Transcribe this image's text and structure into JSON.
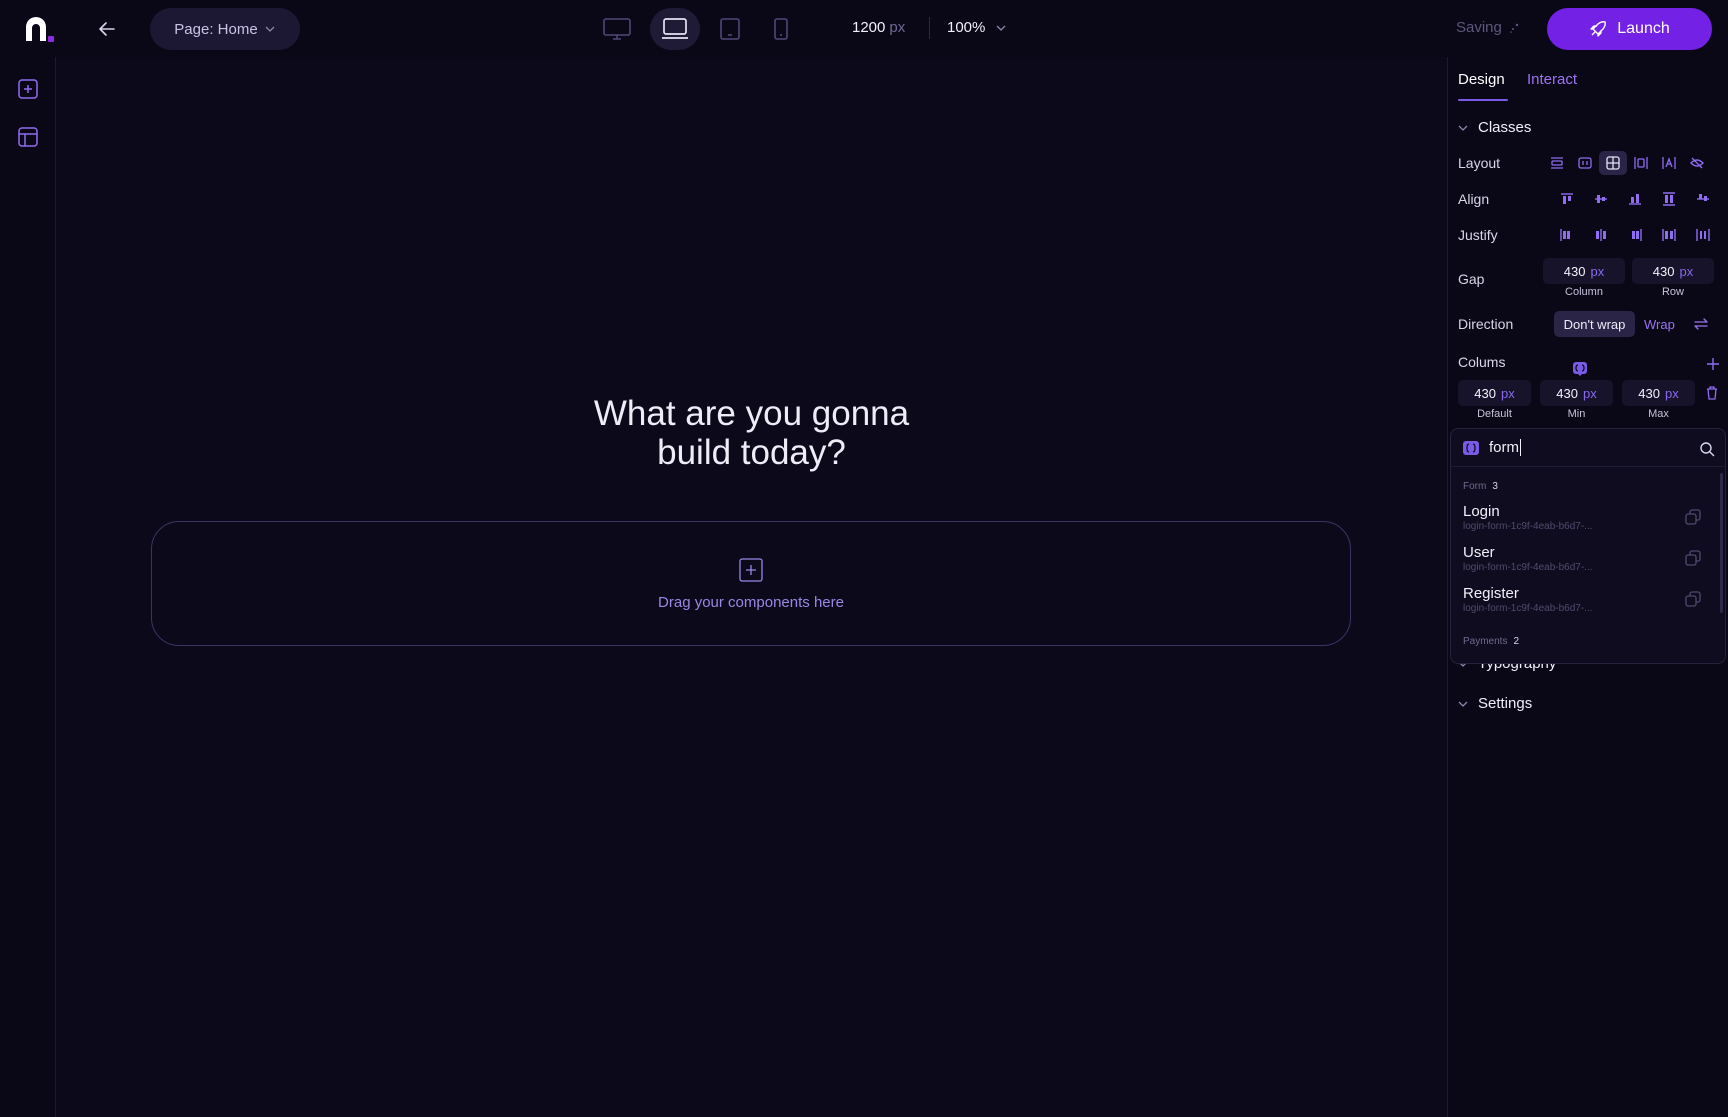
{
  "topbar": {
    "page_select_label": "Page: Home",
    "width_value": "1200",
    "width_unit": "px",
    "zoom_value": "100%",
    "saving_label": "Saving",
    "launch_label": "Launch",
    "devices": [
      "desktop-icon",
      "laptop-icon",
      "tablet-icon",
      "mobile-icon"
    ],
    "active_device": "laptop-icon"
  },
  "canvas": {
    "headline": "What are you gonna\nbuild today?",
    "dropzone_label": "Drag your components here"
  },
  "panel": {
    "tabs": [
      {
        "label": "Design",
        "active": true
      },
      {
        "label": "Interact",
        "active": false
      }
    ],
    "classes_title": "Classes",
    "layout_label": "Layout",
    "align_label": "Align",
    "justify_label": "Justify",
    "gap_label": "Gap",
    "gap": {
      "column": {
        "value": "430",
        "unit": "px",
        "caption": "Column"
      },
      "row": {
        "value": "430",
        "unit": "px",
        "caption": "Row"
      }
    },
    "direction_label": "Direction",
    "direction_options": {
      "selected": "Don't wrap",
      "other": "Wrap"
    },
    "columns_label": "Colums",
    "columns": [
      {
        "value": "430",
        "unit": "px",
        "caption": "Default"
      },
      {
        "value": "430",
        "unit": "px",
        "caption": "Min"
      },
      {
        "value": "430",
        "unit": "px",
        "caption": "Max"
      }
    ],
    "typography_title": "Typography",
    "settings_title": "Settings"
  },
  "dropdown": {
    "query": "form",
    "groups": [
      {
        "label": "Form",
        "count": "3"
      },
      {
        "label": "Payments",
        "count": "2"
      }
    ],
    "items": [
      {
        "name": "Login",
        "id": "login-form-1c9f-4eab-b6d7-..."
      },
      {
        "name": "User",
        "id": "login-form-1c9f-4eab-b6d7-..."
      },
      {
        "name": "Register",
        "id": "login-form-1c9f-4eab-b6d7-..."
      }
    ]
  },
  "colors": {
    "accent": "#7421e6",
    "accent_text": "#9b73f0",
    "background": "#0c0a1a"
  }
}
